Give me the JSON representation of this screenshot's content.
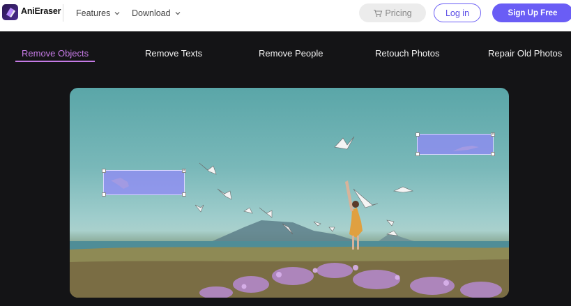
{
  "header": {
    "brand": "AniEraser",
    "nav": [
      {
        "label": "Features",
        "icon": "chevron-down-icon"
      },
      {
        "label": "Download",
        "icon": "chevron-down-icon"
      }
    ],
    "pricing_label": "Pricing",
    "pricing_icon": "cart-icon",
    "login_label": "Log in",
    "signup_label": "Sign Up Free"
  },
  "tabs": [
    {
      "label": "Remove Objects",
      "active": true
    },
    {
      "label": "Remove Texts",
      "active": false
    },
    {
      "label": "Remove People",
      "active": false
    },
    {
      "label": "Retouch Photos",
      "active": false
    },
    {
      "label": "Repair Old Photos",
      "active": false
    }
  ],
  "colors": {
    "accent": "#6a5df5",
    "active_tab": "#c67be6",
    "background": "#141416",
    "selection": "#9187fa"
  }
}
